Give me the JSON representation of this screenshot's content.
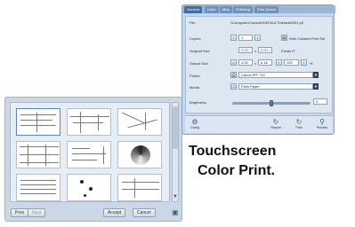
{
  "browser": {
    "buttons": {
      "prev_label": "Prev",
      "next_label": "Next",
      "accept_label": "Accept",
      "cancel_label": "Cancel"
    },
    "corner_icon": "folder-icon"
  },
  "dialog": {
    "tabs": [
      "General",
      "Color",
      "Misc",
      "Finishing",
      "Print Queue"
    ],
    "active_tab": "General",
    "fields": {
      "file_label": "File",
      "file_value": "\\\\Computer\\Console\\DEFAULT\\default0001.plt",
      "copies_label": "Copies",
      "copies_value": "1",
      "collated_label": "Sets Collated Print Set",
      "original_size_label": "Original Size",
      "original_w": "0.00",
      "original_h": "0.00",
      "original_unit": "Points 0\"",
      "output_size_label": "Output Size",
      "output_w": "4.00",
      "output_h": "6.18",
      "output_scale": "100",
      "output_pct": "%",
      "printer_label": "Printer",
      "printer_value": "Canon iPF 710",
      "media_label": "Media",
      "media_value": "Plain Paper",
      "brightness_label": "Brightness",
      "brightness_value": "0"
    },
    "toolbar": {
      "config_label": "Config",
      "reprint_label": "Reprint",
      "print_label": "Print",
      "preview_label": "Preview"
    },
    "brightness_level": 0.5
  },
  "caption": {
    "line1": "Touchscreen",
    "line2": "Color Print."
  }
}
